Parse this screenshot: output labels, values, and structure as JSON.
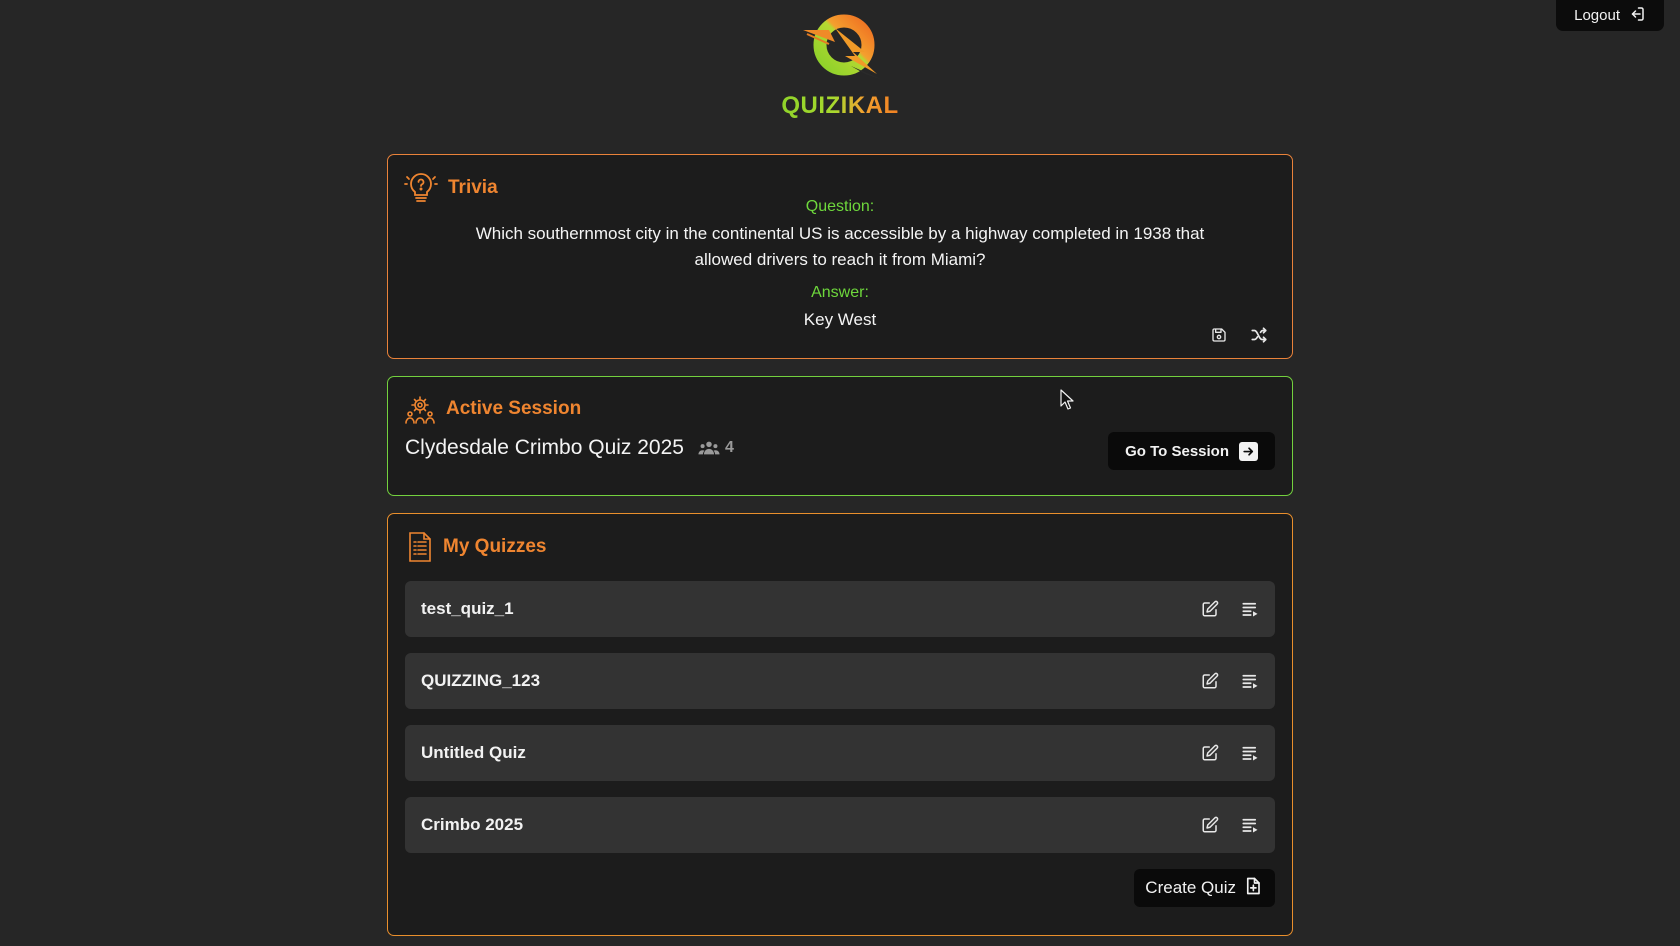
{
  "header": {
    "logout_label": "Logout",
    "brand_name": "QUIZIKAL"
  },
  "colors": {
    "background": "#262626",
    "card": "#1c1c1c",
    "accent_orange": "#ef8530",
    "accent_green": "#6ed83c",
    "button_dark": "#0a0a0a",
    "quiz_row": "#333333"
  },
  "trivia": {
    "title": "Trivia",
    "question_label": "Question:",
    "question": "Which southernmost city in the continental US is accessible by a highway completed in 1938 that allowed drivers to reach it from Miami?",
    "answer_label": "Answer:",
    "answer": "Key West",
    "icons": [
      "lightbulb-question-icon",
      "save-icon",
      "shuffle-icon"
    ]
  },
  "session": {
    "title": "Active Session",
    "name": "Clydesdale Crimbo Quiz 2025",
    "participant_count": "4",
    "go_label": "Go To Session",
    "icons": [
      "people-gears-icon",
      "users-icon",
      "arrow-right-icon"
    ]
  },
  "quizzes": {
    "title": "My Quizzes",
    "items": [
      {
        "name": "test_quiz_1"
      },
      {
        "name": "QUIZZING_123"
      },
      {
        "name": "Untitled Quiz"
      },
      {
        "name": "Crimbo 2025"
      }
    ],
    "create_label": "Create Quiz",
    "icons": [
      "document-list-icon",
      "edit-icon",
      "playlist-play-icon",
      "file-plus-icon"
    ]
  }
}
